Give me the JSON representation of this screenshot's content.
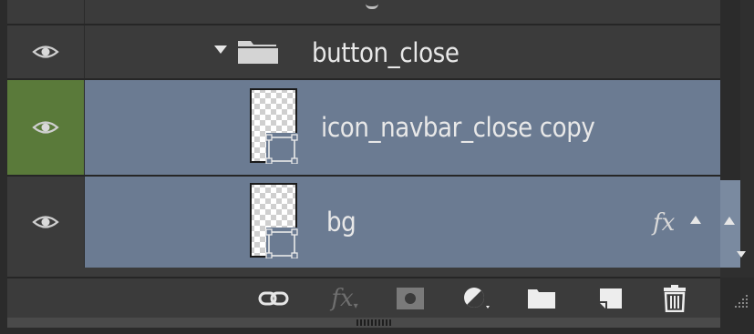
{
  "colors": {
    "panel_bg": "#3b3b3b",
    "selected_bg": "#6b7b92",
    "active_visibility_bg": "#5a7a3a",
    "text": "#e8e8e8"
  },
  "layers": [
    {
      "name": "button_close",
      "type": "group",
      "expanded": true,
      "selected": false,
      "visible": true,
      "icons": [
        "eye-icon",
        "disclosure-triangle-icon",
        "folder-icon"
      ]
    },
    {
      "name": "icon_navbar_close copy",
      "type": "layer",
      "selected": true,
      "visible": true,
      "active": true,
      "icons": [
        "eye-icon",
        "layer-thumbnail-icon"
      ]
    },
    {
      "name": "bg",
      "type": "layer",
      "selected": true,
      "visible": true,
      "has_effects": true,
      "fx_label": "fx",
      "icons": [
        "eye-icon",
        "layer-thumbnail-icon"
      ]
    }
  ],
  "toolbar": {
    "items": [
      {
        "name": "link-layers-icon"
      },
      {
        "name": "fx-icon",
        "label": "fx"
      },
      {
        "name": "mask-icon"
      },
      {
        "name": "adjustment-icon"
      },
      {
        "name": "new-group-icon"
      },
      {
        "name": "new-layer-icon"
      },
      {
        "name": "trash-icon"
      }
    ]
  }
}
